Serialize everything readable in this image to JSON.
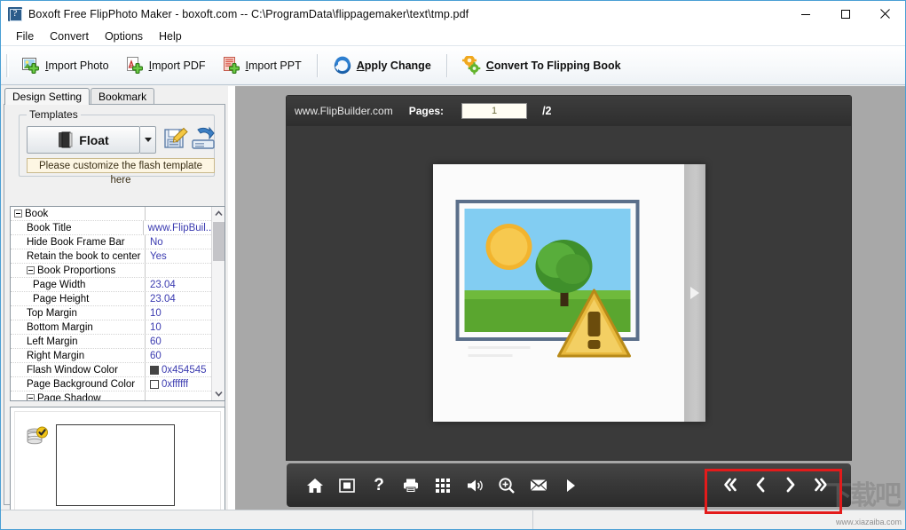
{
  "window": {
    "title": "Boxoft Free FlipPhoto Maker - boxoft.com -- C:\\ProgramData\\flippagemaker\\text\\tmp.pdf",
    "app_icon": "book-icon",
    "minimize": "—",
    "maximize": "□",
    "close": "✕"
  },
  "menubar": {
    "items": [
      {
        "label": "File"
      },
      {
        "label": "Convert"
      },
      {
        "label": "Options"
      },
      {
        "label": "Help"
      }
    ]
  },
  "toolbar": {
    "buttons": [
      {
        "label": "Import Photo",
        "icon": "import-photo-icon",
        "accel": "I"
      },
      {
        "label": "Import PDF",
        "icon": "import-pdf-icon",
        "accel": "I"
      },
      {
        "label": "Import PPT",
        "icon": "import-ppt-icon",
        "accel": "I"
      },
      {
        "label": "Apply Change",
        "icon": "apply-change-icon",
        "accel": "A",
        "bold": true
      },
      {
        "label": "Convert To Flipping Book",
        "icon": "convert-icon",
        "accel": "C",
        "bold": true
      }
    ]
  },
  "left_panel": {
    "tabs": [
      {
        "label": "Design Setting",
        "active": true
      },
      {
        "label": "Bookmark",
        "active": false
      }
    ],
    "templates": {
      "group_title": "Templates",
      "selected": "Float",
      "dropdown_icon": "chevron-down-icon",
      "save_icon": "save-template-icon",
      "load_icon": "load-template-icon",
      "hint": "Please customize the flash template here"
    },
    "property_grid": {
      "rows": [
        {
          "name": "Book",
          "value": "",
          "level": 0,
          "group": true
        },
        {
          "name": "Book Title",
          "value": "www.FlipBuil...",
          "level": 1
        },
        {
          "name": "Hide Book Frame Bar",
          "value": "No",
          "level": 1
        },
        {
          "name": "Retain the book to center",
          "value": "Yes",
          "level": 1
        },
        {
          "name": "Book Proportions",
          "value": "",
          "level": 1,
          "group": true
        },
        {
          "name": "Page Width",
          "value": "23.04",
          "level": 2
        },
        {
          "name": "Page Height",
          "value": "23.04",
          "level": 2
        },
        {
          "name": "Top Margin",
          "value": "10",
          "level": 1
        },
        {
          "name": "Bottom Margin",
          "value": "10",
          "level": 1
        },
        {
          "name": "Left Margin",
          "value": "60",
          "level": 1
        },
        {
          "name": "Right Margin",
          "value": "60",
          "level": 1
        },
        {
          "name": "Flash Window Color",
          "value": "0x454545",
          "level": 1,
          "swatch": "#454545"
        },
        {
          "name": "Page Background Color",
          "value": "0xffffff",
          "level": 1,
          "swatch": "#ffffff"
        },
        {
          "name": "Page Shadow",
          "value": "",
          "level": 1,
          "group": true
        }
      ],
      "scroll_up_icon": "chevron-up-icon",
      "scroll_down_icon": "chevron-down-icon"
    },
    "thumbnails": {
      "database_icon": "database-check-icon",
      "page_thumb": "page-thumbnail"
    }
  },
  "preview": {
    "header": {
      "site": "www.FlipBuilder.com",
      "pages_label": "Pages:",
      "current_page": "1",
      "total_pages": "/2"
    },
    "stage": {
      "image_alt": "broken-image-placeholder",
      "next_page_arrow": "play-arrow-icon"
    },
    "bottom_bar": {
      "tools": [
        {
          "icon": "home-icon",
          "name": "home"
        },
        {
          "icon": "fullscreen-icon",
          "name": "fullscreen"
        },
        {
          "icon": "help-icon",
          "name": "help"
        },
        {
          "icon": "print-icon",
          "name": "print"
        },
        {
          "icon": "thumbnails-icon",
          "name": "thumbnails"
        },
        {
          "icon": "sound-icon",
          "name": "sound"
        },
        {
          "icon": "zoom-in-icon",
          "name": "zoom"
        },
        {
          "icon": "mail-icon",
          "name": "share-email"
        },
        {
          "icon": "play-icon",
          "name": "auto-flip"
        }
      ],
      "nav": [
        {
          "icon": "first-page-icon",
          "name": "first-page",
          "glyph": "«"
        },
        {
          "icon": "previous-page-icon",
          "name": "previous-page",
          "glyph": "‹"
        },
        {
          "icon": "next-page-icon",
          "name": "next-page",
          "glyph": "›"
        },
        {
          "icon": "last-page-icon",
          "name": "last-page",
          "glyph": "»"
        }
      ],
      "highlight_color": "#e31b1b"
    }
  },
  "watermark": {
    "cn_text": "下载吧",
    "url": "www.xiazaiba.com"
  },
  "colors": {
    "title_bar_bg": "#ffffff",
    "toolbar_bg": "#f5f8fa",
    "preview_bg": "#a8a8a8",
    "flash_bg": "#3a3a3a",
    "accent_blue": "#4a9fd4",
    "value_text": "#3b3bb0",
    "highlight_red": "#e31b1b"
  }
}
